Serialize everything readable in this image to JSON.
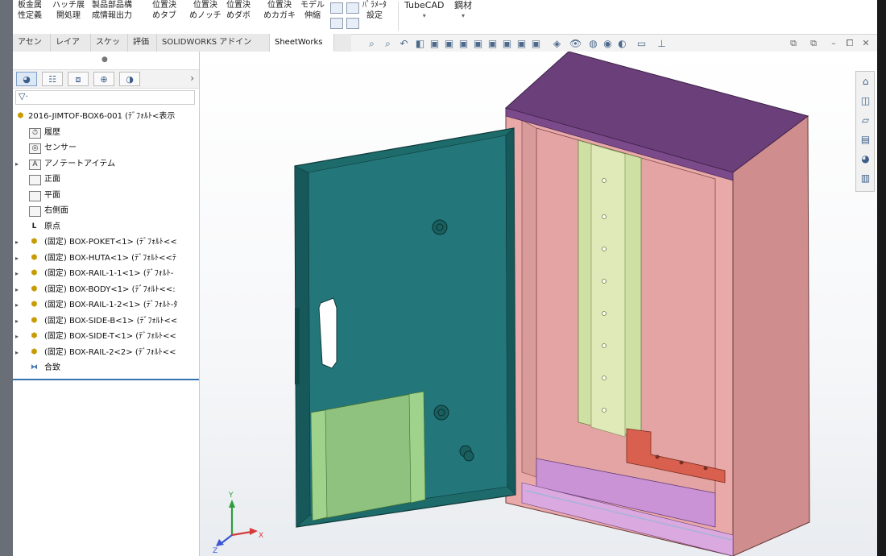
{
  "ribbon": {
    "buttons": [
      {
        "line1": "板金属",
        "line2": "性定義"
      },
      {
        "line1": "ハッチ展",
        "line2": "開処理"
      },
      {
        "line1": "製品部品構",
        "line2": "成情報出力"
      },
      {
        "line1": "位置決",
        "line2": "めタブ"
      },
      {
        "line1": "位置決",
        "line2": "めノッチ"
      },
      {
        "line1": "位置決",
        "line2": "めダボ"
      },
      {
        "line1": "位置決",
        "line2": "めカガキ"
      },
      {
        "line1": "モデル",
        "line2": "伸縮"
      },
      {
        "line1": "ﾊﾟﾗﾒｰﾀ",
        "line2": "設定"
      },
      {
        "line1": "TubeCAD",
        "line2": ""
      },
      {
        "line1": "鋼材",
        "line2": ""
      }
    ]
  },
  "tabs": [
    {
      "label": "アセンブリ"
    },
    {
      "label": "レイアウト"
    },
    {
      "label": "スケッチ"
    },
    {
      "label": "評価"
    },
    {
      "label": "SOLIDWORKS アドイン"
    },
    {
      "label": "SheetWorks"
    }
  ],
  "active_tab": "SheetWorks",
  "feature_tree": {
    "root": "2016-JIMTOF-BOX6-001 (ﾃﾞﾌｫﾙﾄ<表示",
    "items": [
      {
        "label": "履歴",
        "icon": "history-icon"
      },
      {
        "label": "センサー",
        "icon": "sensor-icon"
      },
      {
        "label": "アノテートアイテム",
        "icon": "annotation-icon"
      },
      {
        "label": "正面",
        "icon": "plane-icon"
      },
      {
        "label": "平面",
        "icon": "plane-icon"
      },
      {
        "label": "右側面",
        "icon": "plane-icon"
      },
      {
        "label": "原点",
        "icon": "origin-icon"
      },
      {
        "label": "(固定) BOX-POKET<1> (ﾃﾞﾌｫﾙﾄ<<",
        "icon": "part-icon"
      },
      {
        "label": "(固定) BOX-HUTA<1> (ﾃﾞﾌｫﾙﾄ<<ﾃ",
        "icon": "part-icon"
      },
      {
        "label": "(固定) BOX-RAIL-1-1<1> (ﾃﾞﾌｫﾙﾄ-",
        "icon": "part-icon"
      },
      {
        "label": "(固定) BOX-BODY<1> (ﾃﾞﾌｫﾙﾄ<<:",
        "icon": "part-icon"
      },
      {
        "label": "(固定) BOX-RAIL-1-2<1> (ﾃﾞﾌｫﾙﾄ-ﾀ",
        "icon": "part-icon"
      },
      {
        "label": "(固定) BOX-SIDE-B<1> (ﾃﾞﾌｫﾙﾄ<<",
        "icon": "part-icon"
      },
      {
        "label": "(固定) BOX-SIDE-T<1> (ﾃﾞﾌｫﾙﾄ<<",
        "icon": "part-icon"
      },
      {
        "label": "(固定) BOX-RAIL-2<2> (ﾃﾞﾌｫﾙﾄ<<",
        "icon": "part-icon"
      },
      {
        "label": "合致",
        "icon": "mates-icon"
      }
    ]
  },
  "triad": {
    "x": "X",
    "y": "Y",
    "z": "Z"
  },
  "colors": {
    "door": "#1e6b6b",
    "top": "#6b3f7a",
    "body": "#e9a9a9",
    "rail": "#cfe0a5",
    "pocket": "#8ec27e",
    "bracket": "#d9604e",
    "floor": "#c993d6"
  }
}
